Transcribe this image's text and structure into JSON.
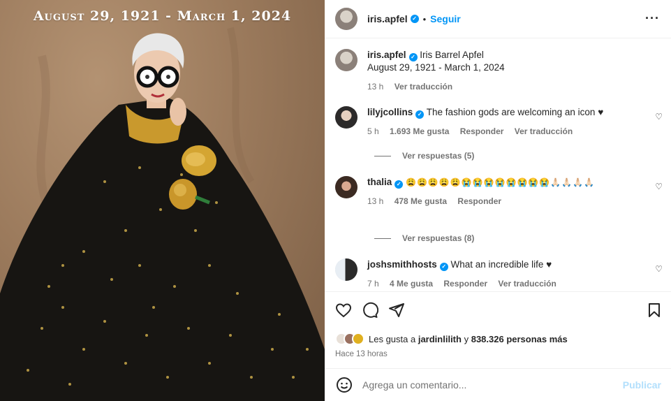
{
  "photo": {
    "caption": "August 29, 1921 - March 1, 2024"
  },
  "header": {
    "username": "iris.apfel",
    "follow_label": "Seguir",
    "more_icon": "more-horizontal-icon"
  },
  "caption": {
    "username": "iris.apfel",
    "text_line1": "Iris Barrel Apfel",
    "text_line2": "August 29, 1921 - March 1, 2024",
    "time": "13 h",
    "translate": "Ver traducción"
  },
  "comments": [
    {
      "username": "lilyjcollins",
      "text": "The fashion gods are welcoming an icon ♥",
      "time": "5 h",
      "likes": "1.693 Me gusta",
      "reply": "Responder",
      "translate": "Ver traducción",
      "replies": "Ver respuestas (5)"
    },
    {
      "username": "thalia",
      "text": "😩😩😩😩😩😭😭😭😭😭😭😭😭🙏🏻🙏🏻🙏🏻🙏🏻",
      "time": "13 h",
      "likes": "478 Me gusta",
      "reply": "Responder",
      "replies": "Ver respuestas (8)"
    },
    {
      "username": "joshsmithhosts",
      "text": "What an incredible life ♥",
      "time": "7 h",
      "likes": "4 Me gusta",
      "reply": "Responder",
      "translate": "Ver traducción"
    }
  ],
  "likes": {
    "prefix": "Les gusta a",
    "user": "jardinlilith",
    "connector": "y",
    "others": "838.326 personas más"
  },
  "posted": "Hace 13 horas",
  "composer": {
    "placeholder": "Agrega un comentario...",
    "publish": "Publicar"
  },
  "colors": {
    "accent": "#0095f6",
    "muted": "#737373",
    "publish_disabled": "#b2dffc"
  }
}
